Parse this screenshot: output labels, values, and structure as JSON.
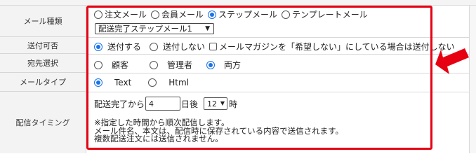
{
  "labels": {
    "mail_type": "メール種類",
    "send_enabled": "送付可否",
    "recipient": "宛先選択",
    "mail_style": "メールタイプ",
    "timing": "配信タイミング"
  },
  "mail_type_options": [
    "注文メール",
    "会員メール",
    "ステップメール",
    "テンプレートメール"
  ],
  "mail_type_selected": "ステップメール",
  "template_select_value": "配送完了ステップメール1",
  "send_enabled_options": [
    "送付する",
    "送付しない"
  ],
  "send_enabled_selected": "送付する",
  "magazine_checkbox_label": "メールマガジンを「希望しない」にしている場合は送付しない",
  "recipient_options": [
    "顧客",
    "管理者",
    "両方"
  ],
  "recipient_selected": "両方",
  "mail_style_options": [
    "Text",
    "Html"
  ],
  "mail_style_selected": "Text",
  "timing": {
    "prefix": "配送完了から",
    "days_value": "4",
    "days_suffix": "日後",
    "hour_value": "12",
    "hour_suffix": "時"
  },
  "notes": [
    "※指定した時間から順次配信します。",
    "メール件名、本文は、配信時に保存されている内容で送信されます。",
    "複数配送注文には送信されません。"
  ],
  "colors": {
    "highlight": "#e60012",
    "radio_selected": "#1a73e8"
  },
  "icons": {
    "select_chevron": "chevron-down-icon",
    "callout": "red-arrow-icon"
  }
}
